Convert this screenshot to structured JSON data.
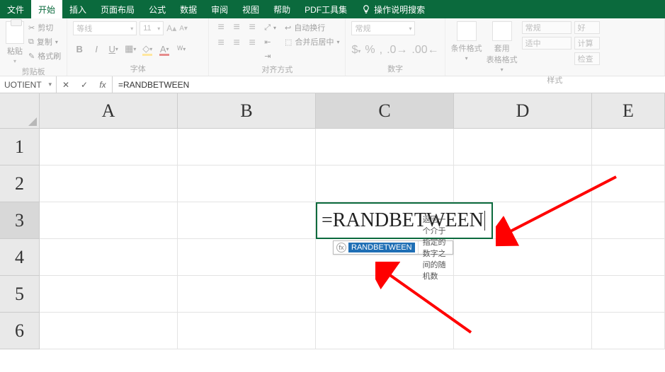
{
  "tabs": {
    "file": "文件",
    "items": [
      "开始",
      "插入",
      "页面布局",
      "公式",
      "数据",
      "审阅",
      "视图",
      "帮助",
      "PDF工具集"
    ],
    "active_index": 0,
    "search_placeholder": "操作说明搜索"
  },
  "ribbon": {
    "clipboard": {
      "cut": "剪切",
      "copy": "复制",
      "format_painter": "格式刷",
      "paste": "粘贴",
      "label": "剪贴板"
    },
    "font": {
      "family": "等线",
      "size": "11",
      "label": "字体"
    },
    "alignment": {
      "wrap": "自动换行",
      "merge": "合并后居中",
      "label": "对齐方式"
    },
    "number": {
      "format": "常规",
      "label": "数字"
    },
    "styles": {
      "cond_format": "条件格式",
      "table_format": "套用\n表格格式",
      "label": "样式",
      "normal": "常规",
      "medium": "适中",
      "good": "好",
      "calc": "计算",
      "check": "检查"
    }
  },
  "formula_bar": {
    "name_box": "UOTIENT",
    "formula": "=RANDBETWEEN"
  },
  "grid": {
    "columns": [
      "A",
      "B",
      "C",
      "D",
      "E"
    ],
    "rows": [
      "1",
      "2",
      "3",
      "4",
      "5",
      "6"
    ],
    "active": {
      "row": 3,
      "col": "C",
      "text": "=RANDBETWEEN"
    },
    "autocomplete": {
      "fn": "RANDBETWEEN",
      "desc": "返回一个介于指定的数字之间的随机数"
    }
  }
}
